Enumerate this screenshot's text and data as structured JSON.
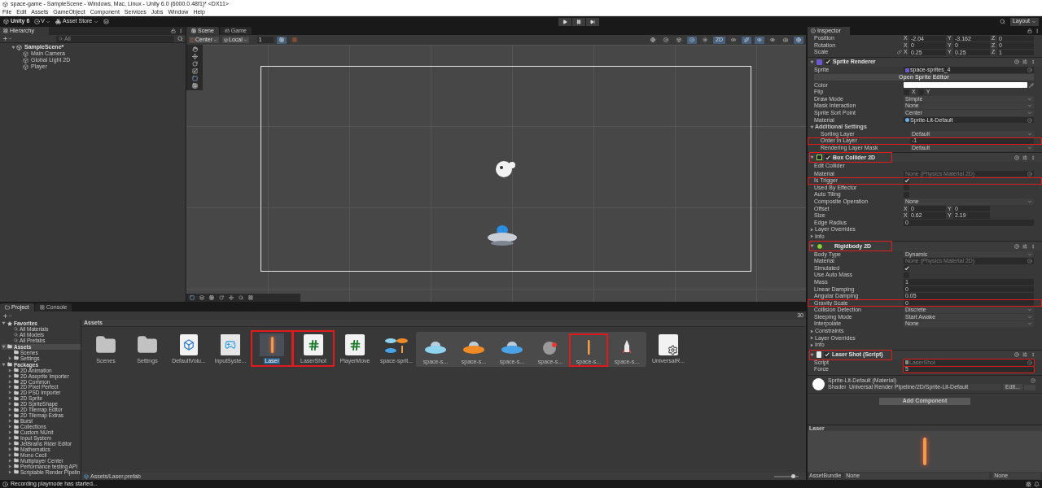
{
  "window": {
    "title": "space-game - SampleScene - Windows, Mac, Linux - Unity 6.0 (6000.0.48f1)* <DX11>"
  },
  "menu": [
    "File",
    "Edit",
    "Assets",
    "GameObject",
    "Component",
    "Services",
    "Jobs",
    "Window",
    "Help"
  ],
  "toolbar": {
    "unity": "Unity 6",
    "account": "V",
    "asset_store": "Asset Store",
    "layout": "Layout"
  },
  "hierarchy": {
    "title": "Hierarchy",
    "search_placeholder": "All",
    "tree": [
      {
        "label": "SampleScene*",
        "expanded": true,
        "children": [
          {
            "label": "Main Camera"
          },
          {
            "label": "Global Light 2D"
          },
          {
            "label": "Player"
          }
        ]
      }
    ]
  },
  "scene": {
    "tabs": [
      {
        "label": "Scene",
        "selected": true
      },
      {
        "label": "Game",
        "selected": false
      }
    ],
    "pivot": "Center",
    "space": "Local",
    "grid": "1",
    "mode_2d": {
      "label": "2D",
      "selected": true
    }
  },
  "inspector": {
    "title": "Inspector",
    "items": [
      {
        "kind": "vector",
        "label": "Position",
        "axes": [
          {
            "axis": "X",
            "value": "-2.04"
          },
          {
            "axis": "Y",
            "value": "-3.162"
          },
          {
            "axis": "Z",
            "value": "0"
          }
        ]
      },
      {
        "kind": "vector",
        "label": "Rotation",
        "axes": [
          {
            "axis": "X",
            "value": "0"
          },
          {
            "axis": "Y",
            "value": "0"
          },
          {
            "axis": "Z",
            "value": "0"
          }
        ]
      },
      {
        "kind": "vector",
        "label": "Scale",
        "linked": true,
        "axes": [
          {
            "axis": "X",
            "value": "0.25"
          },
          {
            "axis": "Y",
            "value": "0.25"
          },
          {
            "axis": "Z",
            "value": "1"
          }
        ]
      },
      {
        "kind": "sprite_header",
        "title": "Sprite Renderer",
        "enabled": true,
        "highlighted": false
      },
      {
        "kind": "sprite_ref",
        "label": "Sprite",
        "value": "space-sprites_4",
        "muted": false
      },
      {
        "kind": "button",
        "label": "Open Sprite Editor"
      },
      {
        "kind": "color",
        "label": "Color",
        "color": "#ffffff"
      },
      {
        "kind": "flip",
        "label": "Flip",
        "options": [
          {
            "label": "X",
            "checked": false
          },
          {
            "label": "Y",
            "checked": false
          }
        ]
      },
      {
        "kind": "dropdown",
        "label": "Draw Mode",
        "value": "Simple"
      },
      {
        "kind": "dropdown",
        "label": "Mask Interaction",
        "value": "None"
      },
      {
        "kind": "dropdown",
        "label": "Sprite Sort Point",
        "value": "Center"
      },
      {
        "kind": "material_ref",
        "label": "Material",
        "value": "Sprite-Lit-Default",
        "muted": false
      },
      {
        "kind": "foldout",
        "label": "Additional Settings",
        "expanded": true,
        "children": [
          {
            "kind": "dropdown",
            "label": "Sorting Layer",
            "value": "Default"
          },
          {
            "kind": "field",
            "label": "Order in Layer",
            "value": "-1",
            "highlighted": true
          },
          {
            "kind": "dropdown",
            "label": "Rendering Layer Mask",
            "value": "Default"
          }
        ]
      },
      {
        "kind": "box_header",
        "title": "Box Collider 2D",
        "enabled": true,
        "highlighted": true
      },
      {
        "kind": "caption",
        "label": "Edit Collider"
      },
      {
        "kind": "none_ref",
        "label": "Material",
        "value": "None (Physics Material 2D)",
        "muted": true
      },
      {
        "kind": "check",
        "label": "Is Trigger",
        "checked": true,
        "highlighted": true
      },
      {
        "kind": "check",
        "label": "Used By Effector",
        "checked": false
      },
      {
        "kind": "check",
        "label": "Auto Tiling",
        "checked": false
      },
      {
        "kind": "dropdown",
        "label": "Composite Operation",
        "value": "None"
      },
      {
        "kind": "vector",
        "label": "Offset",
        "axes": [
          {
            "axis": "X",
            "value": "0"
          },
          {
            "axis": "Y",
            "value": "0"
          }
        ]
      },
      {
        "kind": "vector",
        "label": "Size",
        "axes": [
          {
            "axis": "X",
            "value": "0.62"
          },
          {
            "axis": "Y",
            "value": "2.19"
          }
        ]
      },
      {
        "kind": "field",
        "label": "Edge Radius",
        "value": "0"
      },
      {
        "kind": "foldout",
        "label": "Layer Overrides",
        "expanded": false
      },
      {
        "kind": "foldout",
        "label": "Info",
        "expanded": false
      },
      {
        "kind": "rigidbody_header",
        "title": "Rigidbody 2D",
        "highlighted": true
      },
      {
        "kind": "dropdown",
        "label": "Body Type",
        "value": "Dynamic"
      },
      {
        "kind": "none_ref",
        "label": "Material",
        "value": "None (Physics Material 2D)",
        "muted": true
      },
      {
        "kind": "check",
        "label": "Simulated",
        "checked": true
      },
      {
        "kind": "check",
        "label": "Use Auto Mass",
        "checked": false
      },
      {
        "kind": "field",
        "label": "Mass",
        "value": "1"
      },
      {
        "kind": "field",
        "label": "Linear Damping",
        "value": "0"
      },
      {
        "kind": "field",
        "label": "Angular Damping",
        "value": "0.05"
      },
      {
        "kind": "field",
        "label": "Gravity Scale",
        "value": "0",
        "highlighted": true
      },
      {
        "kind": "dropdown",
        "label": "Collision Detection",
        "value": "Discrete"
      },
      {
        "kind": "dropdown",
        "label": "Sleeping Mode",
        "value": "Start Awake"
      },
      {
        "kind": "dropdown",
        "label": "Interpolate",
        "value": "None"
      },
      {
        "kind": "foldout",
        "label": "Constraints",
        "expanded": false
      },
      {
        "kind": "foldout",
        "label": "Layer Overrides",
        "expanded": false
      },
      {
        "kind": "foldout",
        "label": "Info",
        "expanded": false
      },
      {
        "kind": "script_header",
        "title": "Laser Shot (Script)",
        "enabled": true,
        "highlighted": true
      },
      {
        "kind": "script_ref",
        "label": "Script",
        "value": "LaserShot",
        "muted": true,
        "value_highlighted": true
      },
      {
        "kind": "field",
        "label": "Force",
        "value": "5",
        "value_highlighted": true
      }
    ],
    "material": {
      "name": "Sprite-Lit-Default (Material)",
      "shader_label": "Shader",
      "shader": "Universal Render Pipeline/2D/Sprite-Lit-Default",
      "edit": "Edit..."
    },
    "add_component": "Add Component",
    "preview": {
      "title": "Laser"
    },
    "asset_bundle": {
      "label": "AssetBundle",
      "name": "None",
      "variant": "None"
    }
  },
  "project": {
    "tabs": [
      {
        "label": "Project",
        "selected": true
      },
      {
        "label": "Console",
        "selected": false
      }
    ],
    "item_count": "30",
    "sidebar": [
      {
        "label": "Favorites",
        "kind": "favorites",
        "expanded": true,
        "children": [
          {
            "label": "All Materials",
            "kind": "search"
          },
          {
            "label": "All Models",
            "kind": "search"
          },
          {
            "label": "All Prefabs",
            "kind": "search"
          }
        ]
      },
      {
        "label": "Assets",
        "kind": "folder",
        "expanded": true,
        "selected": true,
        "children": [
          {
            "label": "Scenes",
            "kind": "folder"
          },
          {
            "label": "Settings",
            "kind": "folder",
            "expanded": false
          }
        ]
      },
      {
        "label": "Packages",
        "kind": "folder",
        "expanded": true,
        "children": [
          {
            "label": "2D Animation",
            "kind": "folder",
            "expanded": false
          },
          {
            "label": "2D Aseprite Importer",
            "kind": "folder",
            "expanded": false
          },
          {
            "label": "2D Common",
            "kind": "folder",
            "expanded": false
          },
          {
            "label": "2D Pixel Perfect",
            "kind": "folder",
            "expanded": false
          },
          {
            "label": "2D PSD Importer",
            "kind": "folder",
            "expanded": false
          },
          {
            "label": "2D Sprite",
            "kind": "folder",
            "expanded": false
          },
          {
            "label": "2D SpriteShape",
            "kind": "folder",
            "expanded": false
          },
          {
            "label": "2D Tilemap Editor",
            "kind": "folder",
            "expanded": false
          },
          {
            "label": "2D Tilemap Extras",
            "kind": "folder",
            "expanded": false
          },
          {
            "label": "Burst",
            "kind": "folder",
            "expanded": false
          },
          {
            "label": "Collections",
            "kind": "folder",
            "expanded": false
          },
          {
            "label": "Custom NUnit",
            "kind": "folder",
            "expanded": false
          },
          {
            "label": "Input System",
            "kind": "folder",
            "expanded": false
          },
          {
            "label": "JetBrains Rider Editor",
            "kind": "folder",
            "expanded": false
          },
          {
            "label": "Mathematics",
            "kind": "folder",
            "expanded": false
          },
          {
            "label": "Mono Cecil",
            "kind": "folder",
            "expanded": false
          },
          {
            "label": "Multiplayer Center",
            "kind": "folder",
            "expanded": false
          },
          {
            "label": "Performance testing API",
            "kind": "folder",
            "expanded": false
          },
          {
            "label": "Scriptable Render Pipelin",
            "kind": "folder",
            "expanded": false
          }
        ]
      }
    ],
    "breadcrumb": "Assets",
    "assets": [
      {
        "label": "Scenes",
        "kind": "folder",
        "selected": false,
        "highlighted": false
      },
      {
        "label": "Settings",
        "kind": "folder",
        "selected": false,
        "highlighted": false
      },
      {
        "label": "DefaultVolu...",
        "kind": "volume",
        "selected": false,
        "highlighted": false
      },
      {
        "label": "InputSyste...",
        "kind": "input",
        "selected": false,
        "highlighted": false
      },
      {
        "label": "Laser",
        "kind": "prefab",
        "selected": true,
        "highlighted": true
      },
      {
        "label": "LaserShot",
        "kind": "script",
        "selected": false,
        "highlighted": true
      },
      {
        "label": "PlayerMove",
        "kind": "script",
        "selected": false,
        "highlighted": false
      },
      {
        "label": "space-sprit...",
        "kind": "spritesheet",
        "selected": false,
        "highlighted": false,
        "expanded": true,
        "children": [
          {
            "label": "space-s...",
            "kind": "ufo",
            "color": "#8fd3ee",
            "highlighted": false
          },
          {
            "label": "space-s...",
            "kind": "ufo",
            "color": "#f08a24",
            "highlighted": false
          },
          {
            "label": "space-s...",
            "kind": "ufo",
            "color": "#4aa3e8",
            "highlighted": false
          },
          {
            "label": "space-s...",
            "kind": "asteroid",
            "color": "#e23b3b",
            "highlighted": false
          },
          {
            "label": "space-s...",
            "kind": "laser",
            "color": "#f2a04a",
            "highlighted": true
          },
          {
            "label": "space-s...",
            "kind": "rocket",
            "color": "#e8e8e8",
            "highlighted": false
          }
        ]
      },
      {
        "label": "UniversalR...",
        "kind": "settings",
        "selected": false,
        "highlighted": false
      }
    ],
    "path": "Assets/Laser.prefab",
    "zoom": {
      "level": 0.75
    }
  },
  "status": "Recording playmode has started..."
}
